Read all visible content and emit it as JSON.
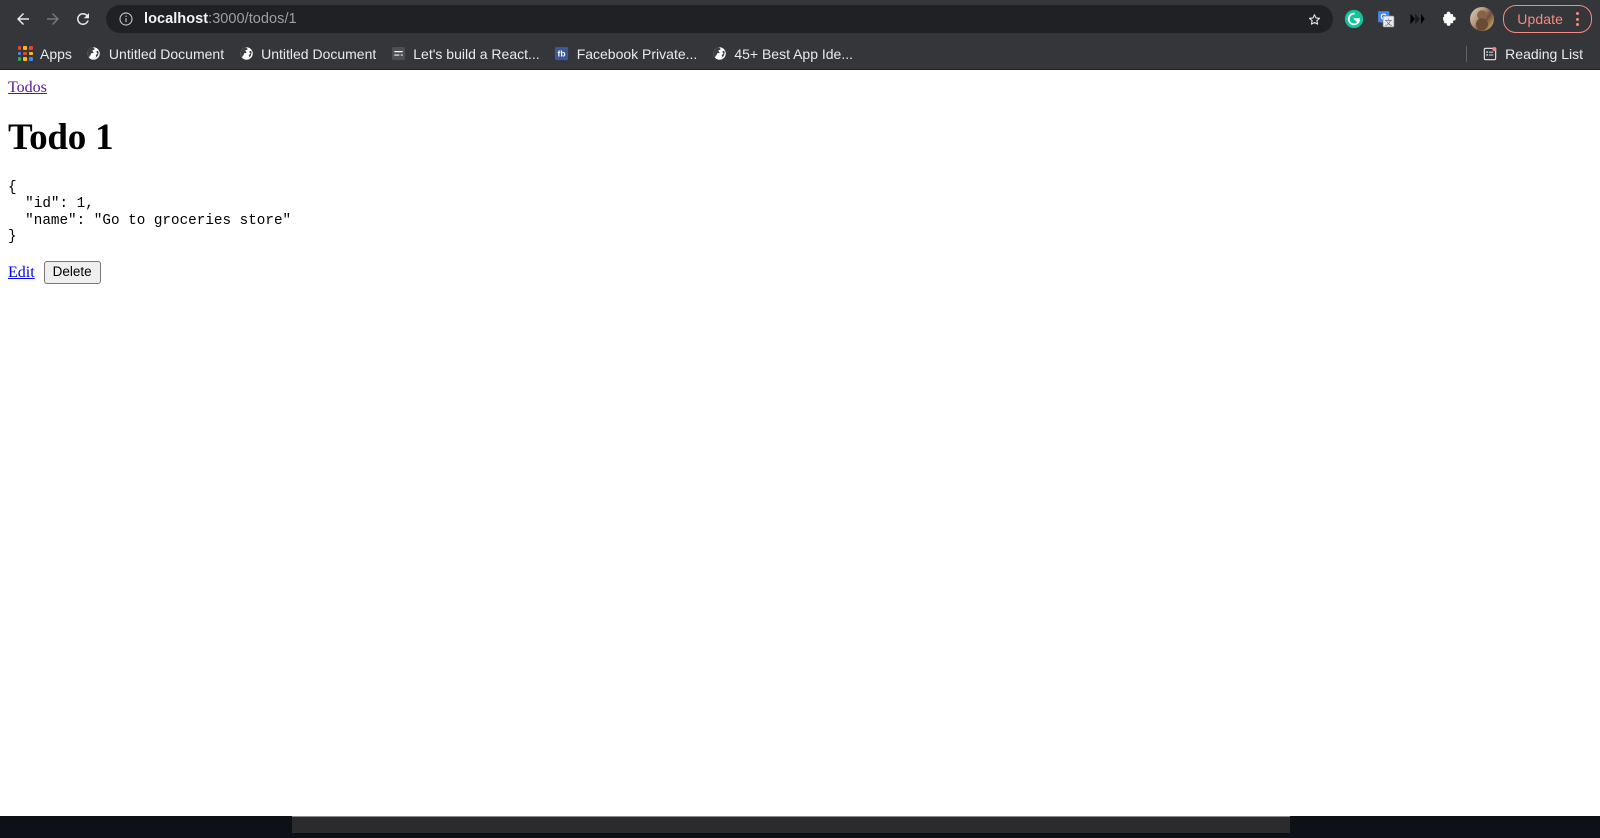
{
  "browser": {
    "nav": {
      "back_title": "Back",
      "forward_title": "Forward",
      "reload_title": "Reload"
    },
    "omnibox": {
      "security_icon": "info-circle-icon",
      "host": "localhost",
      "path": ":3000/todos/1",
      "full_url": "localhost:3000/todos/1",
      "bookmark_icon": "star-icon"
    },
    "toolbar_right": [
      {
        "name": "grammarly-extension-icon",
        "label": "Grammarly",
        "color": "#15c39a"
      },
      {
        "name": "google-translate-extension-icon",
        "label": "Google Translate",
        "color": "#4285f4"
      },
      {
        "name": "medium-extension-icon",
        "label": "Medium",
        "color": "#000000"
      },
      {
        "name": "extensions-puzzle-icon",
        "label": "Extensions",
        "color": "#ffffff"
      }
    ],
    "avatar": {
      "name": "profile-avatar",
      "label": "Profile"
    },
    "update": {
      "label": "Update",
      "accent_color": "#f28b82",
      "menu_icon": "three-dots-vertical-icon"
    },
    "bookmarks": [
      {
        "label": "Apps",
        "icon": "apps-grid-icon"
      },
      {
        "label": "Untitled Document",
        "icon": "globe-icon"
      },
      {
        "label": "Untitled Document",
        "icon": "globe-icon"
      },
      {
        "label": "Let's build a React...",
        "icon": "document-lines-icon"
      },
      {
        "label": "Facebook Private...",
        "icon": "facebook-icon"
      },
      {
        "label": "45+ Best App Ide...",
        "icon": "globe-icon"
      }
    ],
    "reading_list": {
      "label": "Reading List",
      "icon": "reading-list-icon",
      "badge_color": "#f28b82"
    }
  },
  "page": {
    "breadcrumb_link": "Todos",
    "title": "Todo 1",
    "json_text": "{\n  \"id\": 1,\n  \"name\": \"Go to groceries store\"\n}",
    "todo": {
      "id": 1,
      "name": "Go to groceries store"
    },
    "actions": {
      "edit_label": "Edit",
      "delete_label": "Delete"
    },
    "link_visited_color": "#551a8b",
    "link_color": "#0000ee"
  }
}
